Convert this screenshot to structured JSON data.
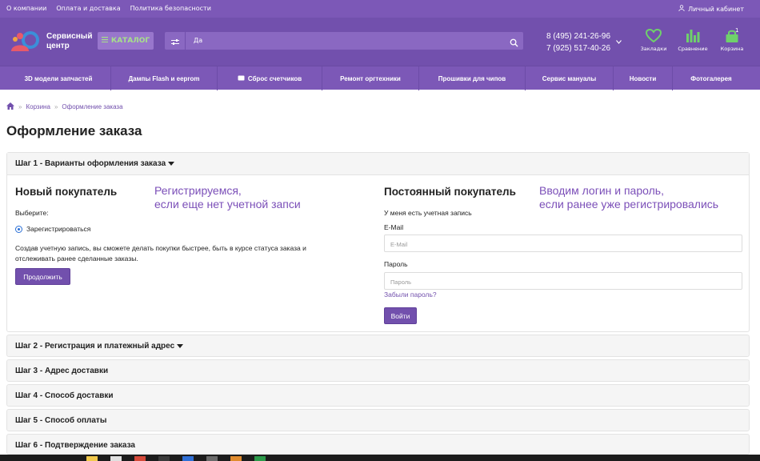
{
  "topbar": {
    "links": [
      "О компании",
      "Оплата и доставка",
      "Политика безопасности"
    ],
    "account": "Личный кабинет"
  },
  "header": {
    "logo_line1": "Сервисный",
    "logo_line2": "центр",
    "catalog_label": "КАТАЛОГ",
    "search_value": "Да",
    "phone1": "8 (495) 241-26-96",
    "phone2": "7 (925) 517-40-26",
    "icons": {
      "bookmarks": "Закладки",
      "compare": "Сравнение",
      "cart": "Корзина",
      "cart_count": "1"
    }
  },
  "nav": [
    "3D модели запчастей",
    "Дампы Flash и eeprom",
    "Сброс счетчиков",
    "Ремонт оргтехники",
    "Прошивки для чипов",
    "Сервис мануалы",
    "Новости",
    "Фотогалерея"
  ],
  "breadcrumb": [
    "Корзина",
    "Оформление заказа"
  ],
  "page_title": "Оформление заказа",
  "step1": {
    "title": "Шаг 1 - Варианты оформления заказа",
    "new_customer": {
      "title": "Новый покупатель",
      "annotation_line1": "Регистрируемся,",
      "annotation_line2": "если еще нет учетной запси",
      "choose": "Выберите:",
      "option": "Зарегистрироваться",
      "desc_line1": "Создав учетную запись, вы сможете делать покупки быстрее, быть в курсе статуса заказа и",
      "desc_line2": "отслеживать ранее сделанные заказы.",
      "continue": "Продолжить"
    },
    "returning_customer": {
      "title": "Постоянный покупатель",
      "annotation_line1": "Вводим логин и пароль,",
      "annotation_line2": "если ранее уже регистрировались",
      "have_account": "У меня есть учетная запись",
      "email_label": "E-Mail",
      "email_placeholder": "E-Mail",
      "password_label": "Пароль",
      "password_placeholder": "Пароль",
      "forgot": "Забыли пароль?",
      "login": "Войти"
    }
  },
  "steps": [
    "Шаг 2 - Регистрация и платежный адрес",
    "Шаг 3 - Адрес доставки",
    "Шаг 4 - Способ доставки",
    "Шаг 5 - Способ оплаты",
    "Шаг 6 - Подтверждение заказа"
  ],
  "colors": {
    "brand": "#7250ad",
    "brand_light": "#7c58b7",
    "accent_green": "#6fd16b",
    "annotation": "#7b4fb8"
  }
}
